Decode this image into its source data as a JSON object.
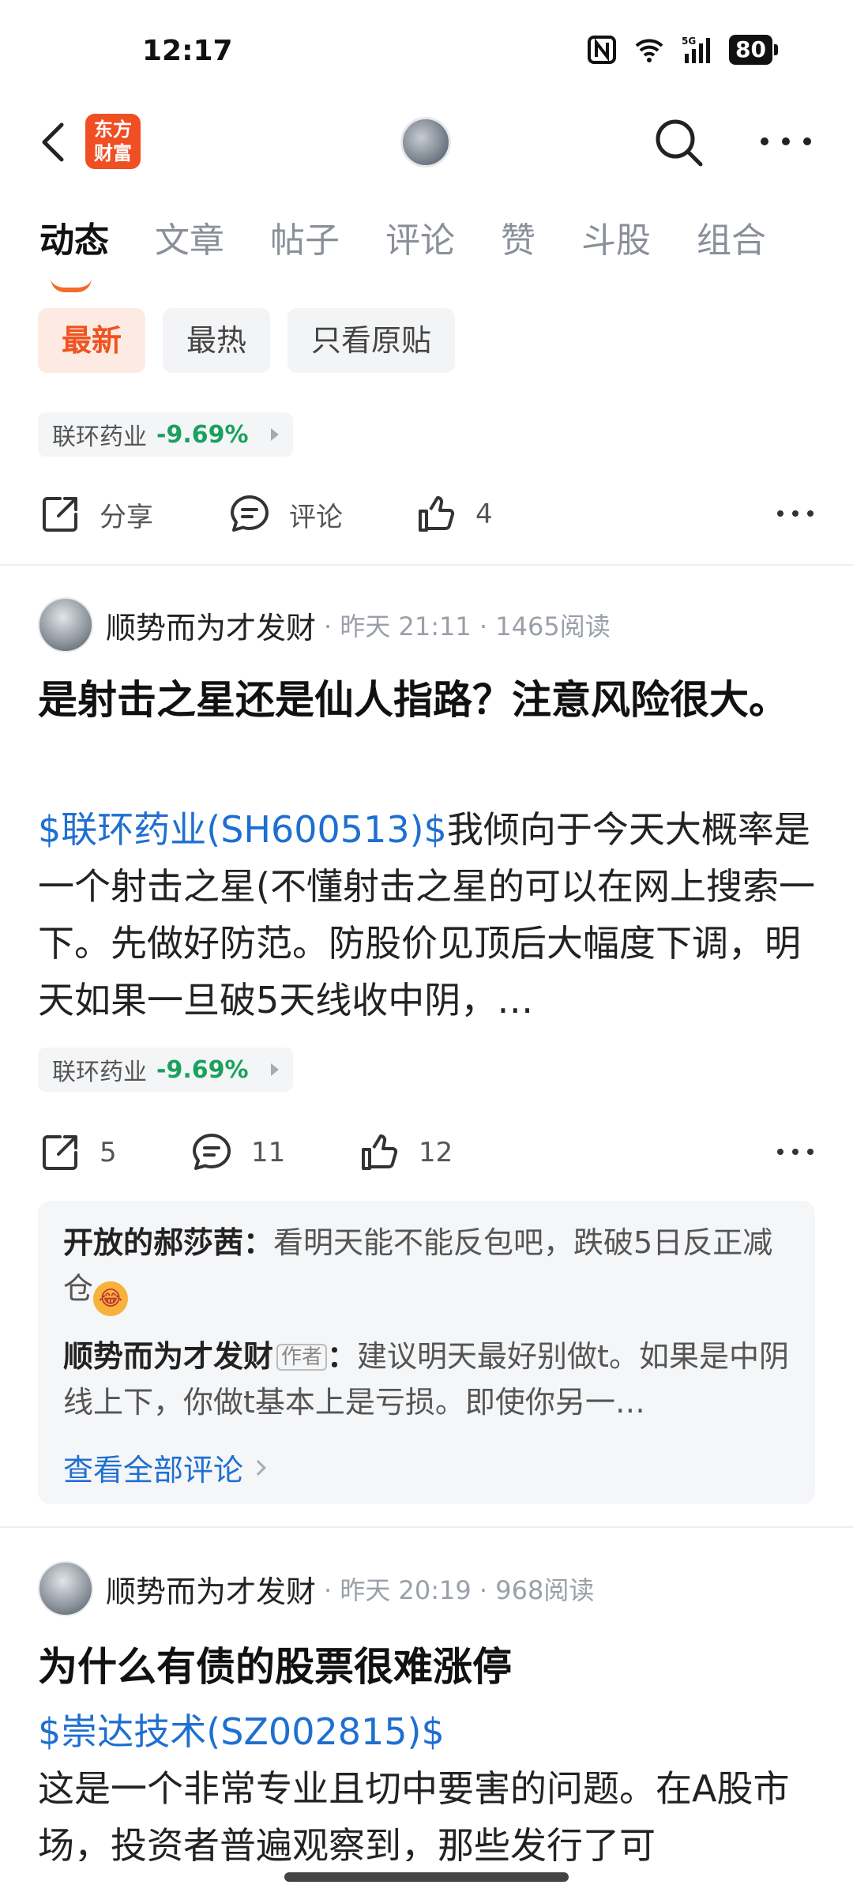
{
  "status_bar": {
    "time": "12:17",
    "battery": "80",
    "network": "5G"
  },
  "header": {
    "logo_line1": "东方",
    "logo_line2": "财富"
  },
  "tabs": [
    {
      "label": "动态",
      "active": true
    },
    {
      "label": "文章"
    },
    {
      "label": "帖子"
    },
    {
      "label": "评论"
    },
    {
      "label": "赞"
    },
    {
      "label": "斗股"
    },
    {
      "label": "组合"
    }
  ],
  "filters": [
    {
      "label": "最新",
      "active": true
    },
    {
      "label": "最热"
    },
    {
      "label": "只看原贴"
    }
  ],
  "first_item": {
    "stock_name": "联环药业",
    "stock_change": "-9.69%",
    "share_label": "分享",
    "comment_label": "评论",
    "like_count": "4"
  },
  "post1": {
    "author": "顺势而为才发财",
    "meta": "· 昨天 21:11 · 1465阅读",
    "title": "是射击之星还是仙人指路？注意风险很大。",
    "stock_link": "$联环药业(SH600513)$",
    "body": "我倾向于今天大概率是一个射击之星(不懂射击之星的可以在网上搜索一下。先做好防范。防股价见顶后大幅度下调，明天如果一旦破5天线收中阴，…",
    "stock_name": "联环药业",
    "stock_change": "-9.69%",
    "share_count": "5",
    "comment_count": "11",
    "like_count": "12",
    "comments": [
      {
        "user": "开放的郝莎茜：",
        "text": "看明天能不能反包吧，跌破5日反正减仓",
        "emoji": "😂"
      },
      {
        "user": "顺势而为才发财",
        "badge": "作者",
        "colon": "：",
        "text": "建议明天最好别做t。如果是中阴线上下，你做t基本上是亏损。即使你另一…"
      }
    ],
    "see_all": "查看全部评论"
  },
  "post2": {
    "author": "顺势而为才发财",
    "meta": "· 昨天 20:19 · 968阅读",
    "title": "为什么有债的股票很难涨停",
    "stock_link": "$崇达技术(SZ002815)$",
    "body": "这是一个非常专业且切中要害的问题。在A股市场，投资者普遍观察到，那些发行了可"
  },
  "colors": {
    "accent": "#f26b2a",
    "link": "#1f6fd1",
    "down_green": "#1aa15d"
  }
}
